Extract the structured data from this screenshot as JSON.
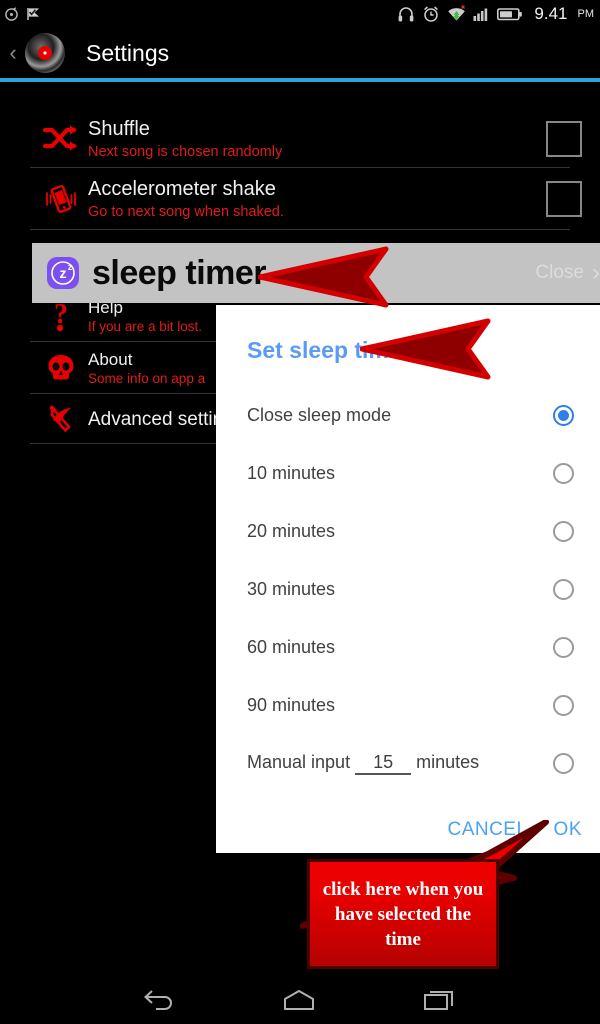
{
  "status_bar": {
    "left_icons": [
      "sync-notification-icon",
      "checkmark-flag-notification-icon"
    ],
    "right_icons": [
      "headphones-icon",
      "alarm-clock-icon",
      "wifi-icon",
      "cell-signal-icon",
      "battery-icon"
    ],
    "time": "9.41",
    "meridiem": "PM"
  },
  "action_bar": {
    "back_glyph": "‹",
    "logo_icon": "vinyl-record-icon",
    "title": "Settings",
    "accent_color": "#2aa3db"
  },
  "settings": {
    "items": [
      {
        "icon": "shuffle-icon",
        "title": "Shuffle",
        "subtitle": "Next song is chosen randomly",
        "control": "checkbox",
        "checked": false
      },
      {
        "icon": "phone-shake-icon",
        "title": "Accelerometer shake",
        "subtitle": "Go to next song when shaked.",
        "control": "checkbox",
        "checked": false
      },
      {
        "icon": "question-mark-icon",
        "title": "Help",
        "subtitle": "If you are a bit lost."
      },
      {
        "icon": "skull-icon",
        "title": "About",
        "subtitle": "Some info on app a"
      },
      {
        "icon": "hammer-and-sickle-icon",
        "title": "Advanced settin"
      }
    ]
  },
  "sleep_timer_row": {
    "icon": "sleep-timer-zz-icon",
    "label": "sleep timer",
    "close_label": "Close",
    "chevron": "›",
    "background_color": "#c3c3c3"
  },
  "dialog": {
    "title": "Set sleep time",
    "title_color": "#5b9bf3",
    "options": [
      {
        "label": "Close sleep mode",
        "selected": true
      },
      {
        "label": "10 minutes",
        "selected": false
      },
      {
        "label": "20 minutes",
        "selected": false
      },
      {
        "label": "30 minutes",
        "selected": false
      },
      {
        "label": "60 minutes",
        "selected": false
      },
      {
        "label": "90 minutes",
        "selected": false
      }
    ],
    "manual": {
      "prefix": "Manual input",
      "value": "15",
      "suffix": "minutes",
      "selected": false
    },
    "buttons": {
      "cancel": "CANCEL",
      "ok": "OK"
    }
  },
  "annotations": {
    "arrow_to_sleep_timer": "left-pointing-arrow",
    "arrow_to_dialog_title": "left-pointing-arrow",
    "arrow_to_ok": "up-right-pointing-arrow",
    "callout_text": "click here when you have selected the time"
  },
  "nav_bar": {
    "back": "back-nav-icon",
    "home": "home-nav-icon",
    "recents": "recents-nav-icon"
  }
}
